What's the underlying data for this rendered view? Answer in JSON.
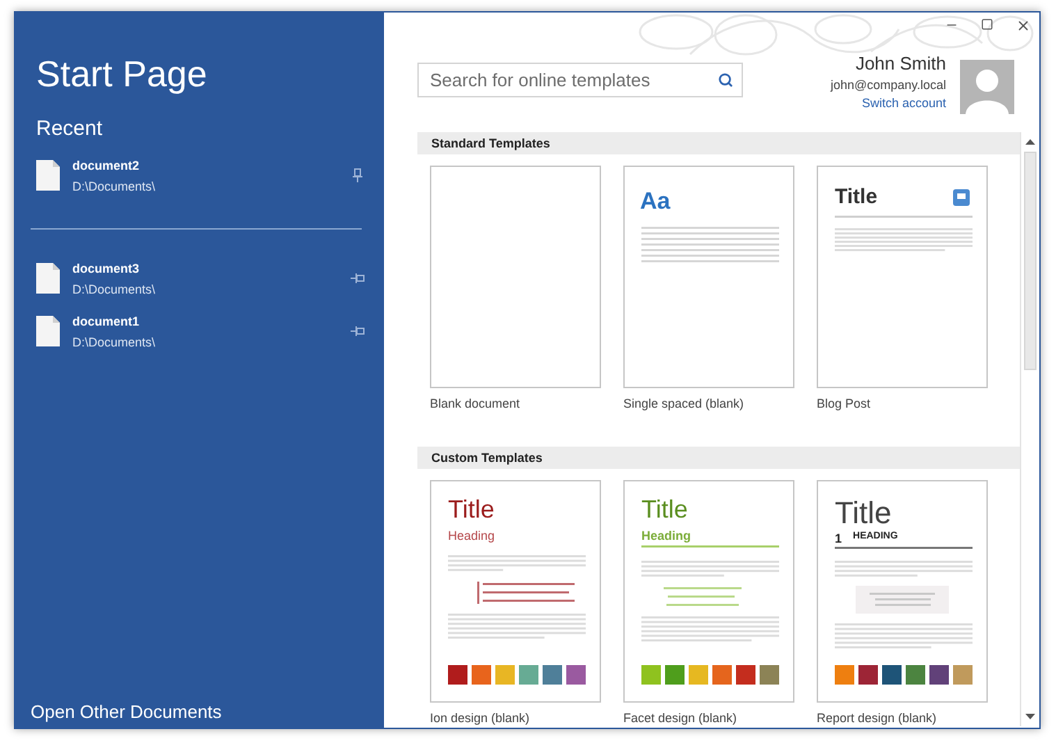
{
  "sidebar": {
    "title": "Start Page",
    "recent_heading": "Recent",
    "open_other": "Open Other Documents",
    "recent": [
      {
        "name": "document2",
        "path": "D:\\Documents\\",
        "pinned": true
      },
      {
        "name": "document3",
        "path": "D:\\Documents\\",
        "pinned": false
      },
      {
        "name": "document1",
        "path": "D:\\Documents\\",
        "pinned": false
      }
    ]
  },
  "search": {
    "placeholder": "Search for online templates"
  },
  "account": {
    "name": "John Smith",
    "email": "john@company.local",
    "switch_label": "Switch account"
  },
  "sections": [
    {
      "title": "Standard Templates",
      "templates": [
        {
          "kind": "blank",
          "label": "Blank document"
        },
        {
          "kind": "single",
          "label": "Single spaced (blank)",
          "title": "Aa"
        },
        {
          "kind": "blog",
          "label": "Blog Post",
          "title": "Title"
        }
      ]
    },
    {
      "title": "Custom Templates",
      "templates": [
        {
          "kind": "ion",
          "label": "Ion design (blank)",
          "title": "Title",
          "heading": "Heading",
          "swatches": [
            {
              "color": "#b01c1c"
            },
            {
              "color": "#e8641c"
            },
            {
              "color": "#e8b624"
            },
            {
              "color": "#67ab94"
            },
            {
              "color": "#4f7f99"
            },
            {
              "color": "#9a5aa0"
            }
          ]
        },
        {
          "kind": "facet",
          "label": "Facet design (blank)",
          "title": "Title",
          "heading": "Heading",
          "swatches": [
            {
              "color": "#8fc21f"
            },
            {
              "color": "#4f9e1c"
            },
            {
              "color": "#e6b821"
            },
            {
              "color": "#e5651d"
            },
            {
              "color": "#c42d1e"
            },
            {
              "color": "#8c8356"
            }
          ]
        },
        {
          "kind": "report",
          "label": "Report design (blank)",
          "title": "Title",
          "number": "1",
          "heading": "HEADING",
          "swatches": [
            {
              "color": "#ee7f10"
            },
            {
              "color": "#9d2536"
            },
            {
              "color": "#1e5478"
            },
            {
              "color": "#4c8440"
            },
            {
              "color": "#614179"
            },
            {
              "color": "#c09a5c"
            }
          ]
        }
      ]
    }
  ]
}
